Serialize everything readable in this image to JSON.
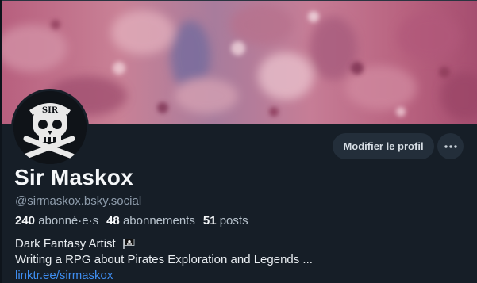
{
  "profile": {
    "display_name": "Sir Maskox",
    "handle": "@sirmaskox.bsky.social",
    "followers_count": "240",
    "followers_label": "abonné·e·s",
    "following_count": "48",
    "following_label": "abonnements",
    "posts_count": "51",
    "posts_label": "posts",
    "bio_line1": "Dark Fantasy Artist",
    "bio_line2": "Writing a RPG about Pirates Exploration and Legends ...",
    "link": "linktr.ee/sirmaskox",
    "avatar_text": "SIR"
  },
  "actions": {
    "edit_profile_label": "Modifier le profil",
    "more_icon": "ellipsis-icon"
  },
  "colors": {
    "background": "#161e27",
    "button_bg": "#232e3a",
    "link": "#3f8ef1",
    "handle": "#8e9cab",
    "banner_base": "#c97a93"
  }
}
